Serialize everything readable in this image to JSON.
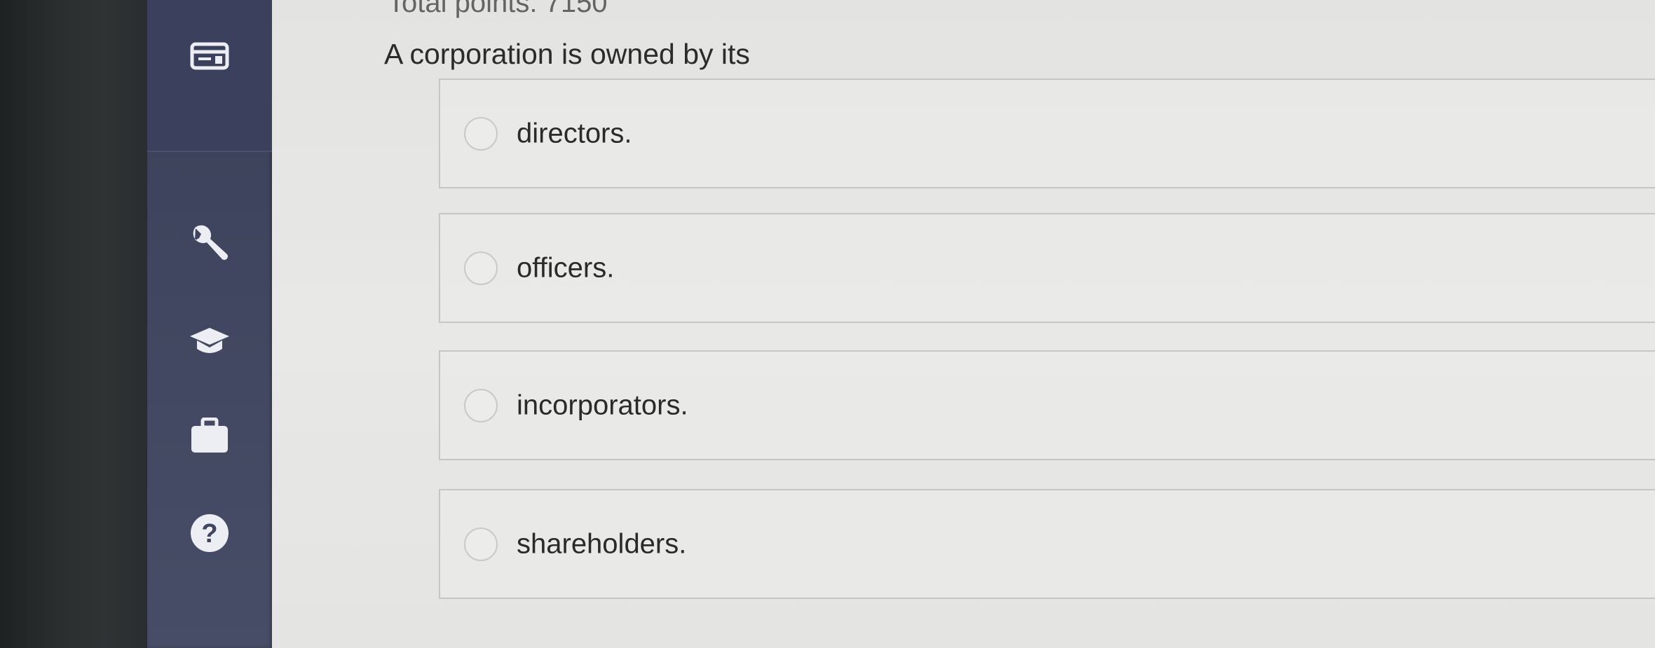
{
  "sidebar": {
    "icons": [
      {
        "name": "layout-icon"
      },
      {
        "name": "wrench-icon"
      },
      {
        "name": "graduation-cap-icon"
      },
      {
        "name": "briefcase-icon"
      },
      {
        "name": "help-icon",
        "glyph": "?"
      }
    ]
  },
  "header": {
    "partial_text": "Total points: 7150"
  },
  "question": {
    "text": "A corporation is owned by its",
    "options": [
      {
        "label": "directors."
      },
      {
        "label": "officers."
      },
      {
        "label": "incorporators."
      },
      {
        "label": "shareholders."
      }
    ]
  },
  "colors": {
    "sidebar": "#40465f",
    "background": "#e6e6e4",
    "text": "#2b2b2b"
  }
}
